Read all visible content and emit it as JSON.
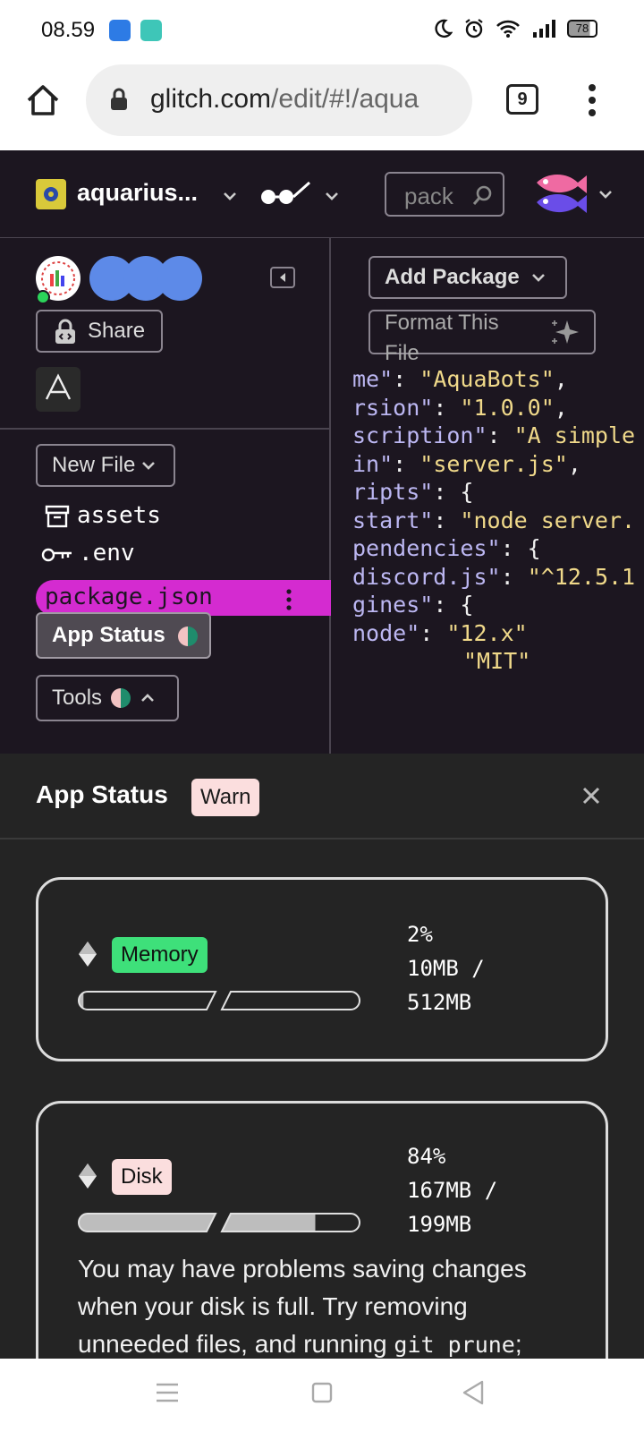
{
  "status_bar": {
    "time": "08.59",
    "battery": "78"
  },
  "browser": {
    "url_host": "glitch.com",
    "url_path": "/edit/#!/aqua",
    "tab_count": "9"
  },
  "editor": {
    "project_name": "aquarius...",
    "search_placeholder": "pack",
    "share_label": "Share",
    "new_file_label": "New File",
    "files": [
      "assets",
      ".env",
      "package.json"
    ],
    "app_status_label": "App Status",
    "tools_label": "Tools",
    "add_package_label": "Add Package",
    "format_file_label": "Format This File",
    "code_lines": [
      [
        [
          "k",
          "me\""
        ],
        [
          "p",
          ": "
        ],
        [
          "s",
          "\"AquaBots\""
        ],
        [
          "p",
          ","
        ]
      ],
      [
        [
          "k",
          "rsion\""
        ],
        [
          "p",
          ": "
        ],
        [
          "s",
          "\"1.0.0\""
        ],
        [
          "p",
          ","
        ]
      ],
      [
        [
          "k",
          "scription\""
        ],
        [
          "p",
          ": "
        ],
        [
          "s",
          "\"A simple"
        ]
      ],
      [
        [
          "k",
          "in\""
        ],
        [
          "p",
          ": "
        ],
        [
          "s",
          "\"server.js\""
        ],
        [
          "p",
          ","
        ]
      ],
      [
        [
          "k",
          "ripts\""
        ],
        [
          "p",
          ": {"
        ]
      ],
      [
        [
          "k",
          "start\""
        ],
        [
          "p",
          ": "
        ],
        [
          "s",
          "\"node server."
        ]
      ],
      [
        [
          "p",
          ""
        ]
      ],
      [
        [
          "k",
          "pendencies\""
        ],
        [
          "p",
          ": {"
        ]
      ],
      [
        [
          "k",
          "discord.js\""
        ],
        [
          "p",
          ": "
        ],
        [
          "s",
          "\"^12.5.1"
        ]
      ],
      [
        [
          "p",
          ""
        ]
      ],
      [
        [
          "k",
          "gines\""
        ],
        [
          "p",
          ": {"
        ]
      ],
      [
        [
          "k",
          "node\""
        ],
        [
          "p",
          ": "
        ],
        [
          "s",
          "\"12.x\""
        ]
      ],
      [
        [
          "p",
          ""
        ]
      ],
      [
        [
          "s",
          "\"MIT\""
        ]
      ]
    ]
  },
  "panel": {
    "title": "App Status",
    "status_badge": "Warn",
    "memory": {
      "label": "Memory",
      "percent_text": "2%",
      "usage_line1": "10MB /",
      "usage_line2": "512MB",
      "fill_fraction": 0.02,
      "badge_color": "#3ee07a"
    },
    "disk": {
      "label": "Disk",
      "percent_text": "84%",
      "usage_line1": "167MB /",
      "usage_line2": "199MB",
      "fill_fraction": 0.84,
      "badge_color": "#fbdede",
      "note_before_code": "You may have problems saving changes when your disk is full. Try removing unneeded files, and running ",
      "note_code": "git prune",
      "note_after_code": ";"
    }
  },
  "colors": {
    "editor_bg": "#1c1620",
    "selected_file": "#d42bd0",
    "panel_bg": "#242424"
  }
}
